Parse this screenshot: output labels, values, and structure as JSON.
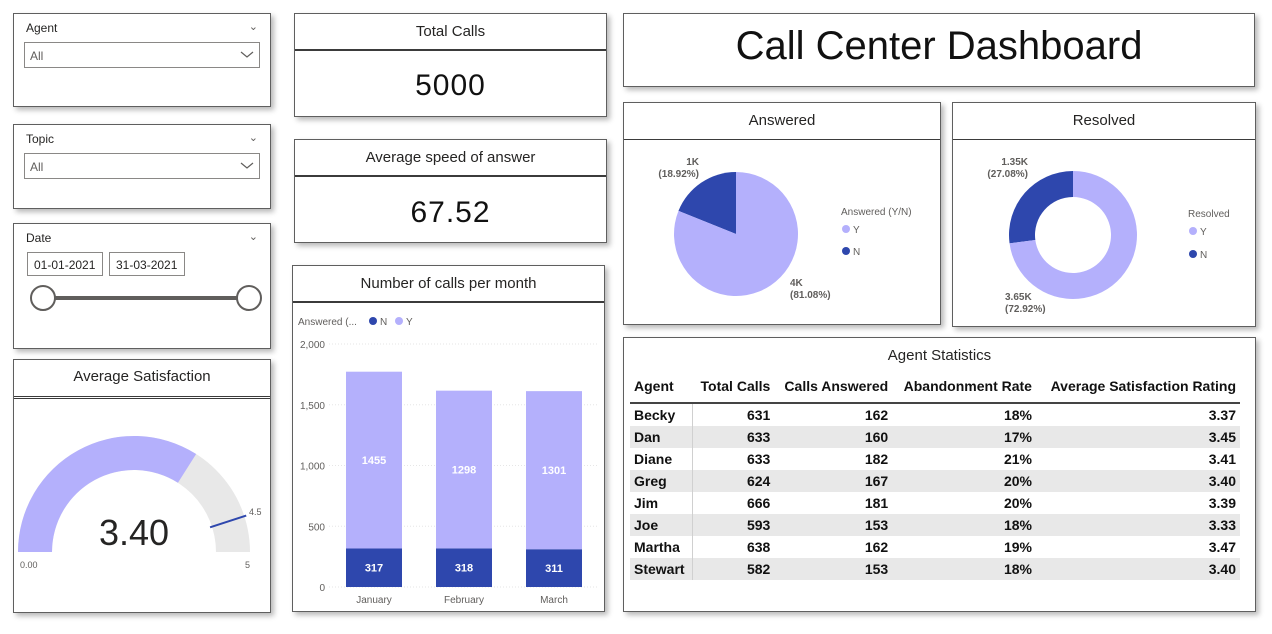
{
  "colors": {
    "light": "#b4b0fc",
    "dark": "#2e47ad",
    "gauge_bg": "#e8e8e8",
    "target": "#2e47ad"
  },
  "slicers": {
    "agent": {
      "title": "Agent",
      "value": "All"
    },
    "topic": {
      "title": "Topic",
      "value": "All"
    },
    "date": {
      "title": "Date",
      "start": "01-01-2021",
      "end": "31-03-2021"
    }
  },
  "kpis": {
    "total_calls": {
      "title": "Total Calls",
      "value": "5000"
    },
    "speed": {
      "title": "Average speed of answer",
      "value": "67.52"
    }
  },
  "dashboard_title": "Call Center Dashboard",
  "gauge": {
    "title": "Average Satisfaction",
    "value_label": "3.40",
    "min_label": "0.00",
    "max_label": "5",
    "target_label": "4.5"
  },
  "chart_data": [
    {
      "type": "bar",
      "title": "Number of calls per month",
      "legend_title": "Answered (...",
      "legend": [
        "N",
        "Y"
      ],
      "categories": [
        "January",
        "February",
        "March"
      ],
      "series": [
        {
          "name": "N",
          "values": [
            317,
            318,
            311
          ]
        },
        {
          "name": "Y",
          "values": [
            1455,
            1298,
            1301
          ]
        }
      ],
      "value_labels": {
        "N": [
          "317",
          "318",
          "311"
        ],
        "Y": [
          "1455",
          "1298",
          "1301"
        ]
      },
      "ylim": [
        0,
        2000
      ],
      "yticks": [
        "0",
        "500",
        "1,000",
        "1,500",
        "2,000"
      ],
      "stacked": true
    },
    {
      "type": "pie",
      "title": "Answered",
      "legend_title": "Answered (Y/N)",
      "legend": [
        "Y",
        "N"
      ],
      "slices": [
        {
          "name": "Y",
          "value": 81.08,
          "label_top": "4K",
          "label_bottom": "(81.08%)"
        },
        {
          "name": "N",
          "value": 18.92,
          "label_top": "1K",
          "label_bottom": "(18.92%)"
        }
      ]
    },
    {
      "type": "pie",
      "title": "Resolved",
      "donut": true,
      "legend_title": "Resolved",
      "legend": [
        "Y",
        "N"
      ],
      "slices": [
        {
          "name": "Y",
          "value": 72.92,
          "label_top": "3.65K",
          "label_bottom": "(72.92%)"
        },
        {
          "name": "N",
          "value": 27.08,
          "label_top": "1.35K",
          "label_bottom": "(27.08%)"
        }
      ]
    }
  ],
  "agent_stats": {
    "title": "Agent Statistics",
    "columns": [
      "Agent",
      "Total Calls",
      "Calls Answered",
      "Abandonment Rate",
      "Average Satisfaction Rating"
    ],
    "rows": [
      [
        "Becky",
        "631",
        "162",
        "18%",
        "3.37"
      ],
      [
        "Dan",
        "633",
        "160",
        "17%",
        "3.45"
      ],
      [
        "Diane",
        "633",
        "182",
        "21%",
        "3.41"
      ],
      [
        "Greg",
        "624",
        "167",
        "20%",
        "3.40"
      ],
      [
        "Jim",
        "666",
        "181",
        "20%",
        "3.39"
      ],
      [
        "Joe",
        "593",
        "153",
        "18%",
        "3.33"
      ],
      [
        "Martha",
        "638",
        "162",
        "19%",
        "3.47"
      ],
      [
        "Stewart",
        "582",
        "153",
        "18%",
        "3.40"
      ]
    ]
  }
}
